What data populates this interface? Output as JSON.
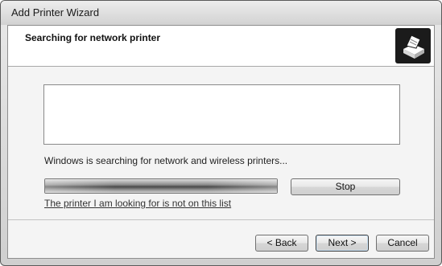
{
  "window": {
    "title": "Add Printer Wizard"
  },
  "header": {
    "title": "Searching for network printer",
    "icon": "printer-icon"
  },
  "main": {
    "status_text": "Windows is searching for network and wireless printers...",
    "progress": {
      "state": "indeterminate"
    },
    "stop_label": "Stop",
    "not_listed_link": "The printer I am looking for is not on this list"
  },
  "footer": {
    "back_label": "< Back",
    "next_label": "Next >",
    "cancel_label": "Cancel"
  }
}
